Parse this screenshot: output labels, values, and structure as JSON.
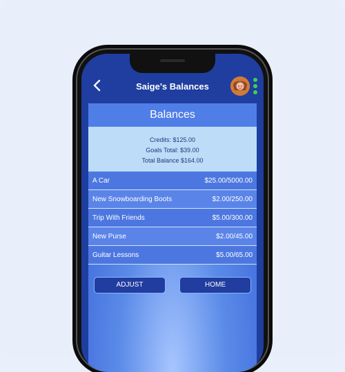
{
  "header": {
    "title": "Saige's Balances"
  },
  "section": {
    "title": "Balances"
  },
  "summary": {
    "credits": "Credits: $125.00",
    "goals_total": "Goals Total: $39.00",
    "total_balance": "Total Balance $164.00"
  },
  "goals": [
    {
      "name": "A Car",
      "amount": "$25.00/5000.00"
    },
    {
      "name": "New Snowboarding Boots",
      "amount": "$2.00/250.00"
    },
    {
      "name": "Trip With Friends",
      "amount": "$5.00/300.00"
    },
    {
      "name": "New Purse",
      "amount": "$2.00/45.00"
    },
    {
      "name": "Guitar Lessons",
      "amount": "$5.00/65.00"
    }
  ],
  "buttons": {
    "adjust": "ADJUST",
    "home": "HOME"
  },
  "icons": {
    "back": "chevron-left-icon",
    "more": "vertical-dots-icon"
  },
  "colors": {
    "header_bg": "#1f3ea0",
    "button_bg": "#213d9f",
    "status_green": "#39d353"
  }
}
